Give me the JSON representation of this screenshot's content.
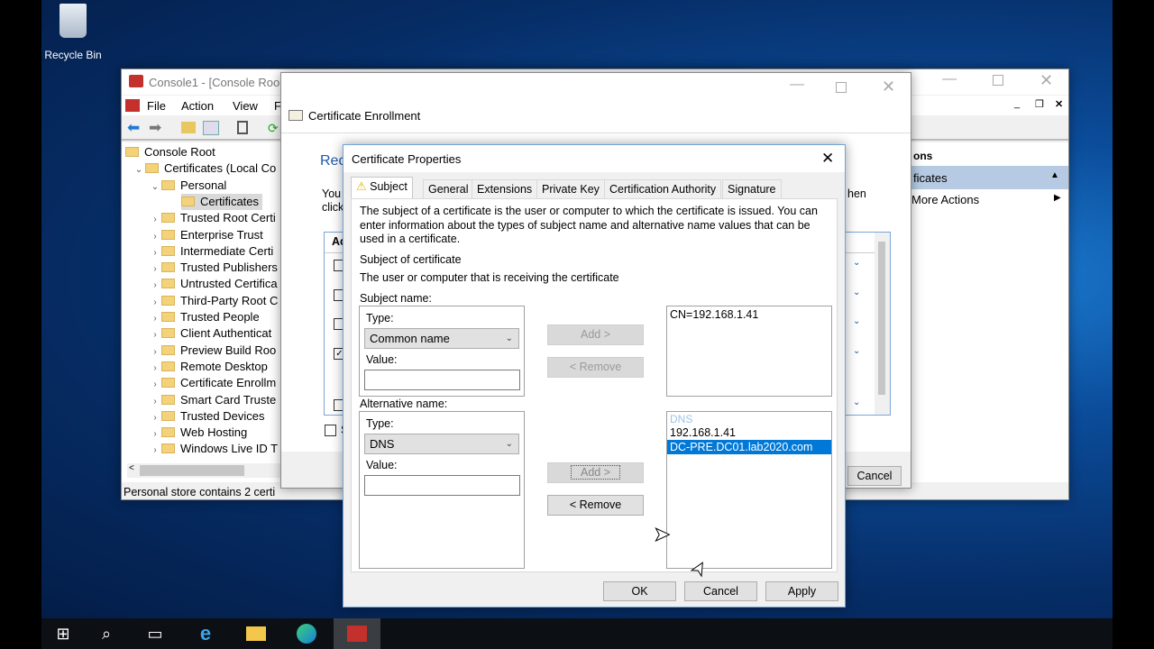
{
  "desktop": {
    "recycle_bin": "Recycle Bin"
  },
  "mmc": {
    "title": "Console1 - [Console Roo",
    "menu": [
      "File",
      "Action",
      "View",
      "F"
    ],
    "tree": [
      "Console Root",
      "Certificates (Local Co",
      "Personal",
      "Certificates",
      "Trusted Root Certi",
      "Enterprise Trust",
      "Intermediate Certi",
      "Trusted Publishers",
      "Untrusted Certifica",
      "Third-Party Root C",
      "Trusted People",
      "Client Authenticat",
      "Preview Build Roo",
      "Remote Desktop",
      "Certificate Enrollm",
      "Smart Card Truste",
      "Trusted Devices",
      "Web Hosting",
      "Windows Live ID T"
    ],
    "status": "Personal store contains 2 certi",
    "actions": {
      "header": "ons",
      "section": "ficates",
      "more": "More Actions"
    }
  },
  "enroll": {
    "title": "Certificate Enrollment",
    "heading": "Rec",
    "text1": "You",
    "text2": "click",
    "text_right": "hen",
    "col": "Ac",
    "show_all": "S",
    "cancel": "Cancel"
  },
  "dialog": {
    "title": "Certificate Properties",
    "tabs": [
      "Subject",
      "General",
      "Extensions",
      "Private Key",
      "Certification Authority",
      "Signature"
    ],
    "description": "The subject of a certificate is the user or computer to which the certificate is issued. You can enter information about the types of subject name and alternative name values that can be used in a certificate.",
    "subject_heading": "Subject of certificate",
    "subject_sub": "The user or computer that is receiving the certificate",
    "subject_name": {
      "label": "Subject name:",
      "type_label": "Type:",
      "type_value": "Common name",
      "value_label": "Value:",
      "value": "",
      "add": "Add >",
      "remove": "< Remove",
      "entries": [
        "CN=192.168.1.41"
      ]
    },
    "alt_name": {
      "label": "Alternative name:",
      "type_label": "Type:",
      "type_value": "DNS",
      "value_label": "Value:",
      "value": "",
      "add": "Add >",
      "remove": "< Remove",
      "group_header": "DNS",
      "entries": [
        "192.168.1.41",
        "DC-PRE.DC01.lab2020.com"
      ],
      "selected": "DC-PRE.DC01.lab2020.com"
    },
    "ok": "OK",
    "cancel": "Cancel",
    "apply": "Apply"
  },
  "colors": {
    "selection": "#0078d7",
    "desktop": "#0b4c9a"
  }
}
